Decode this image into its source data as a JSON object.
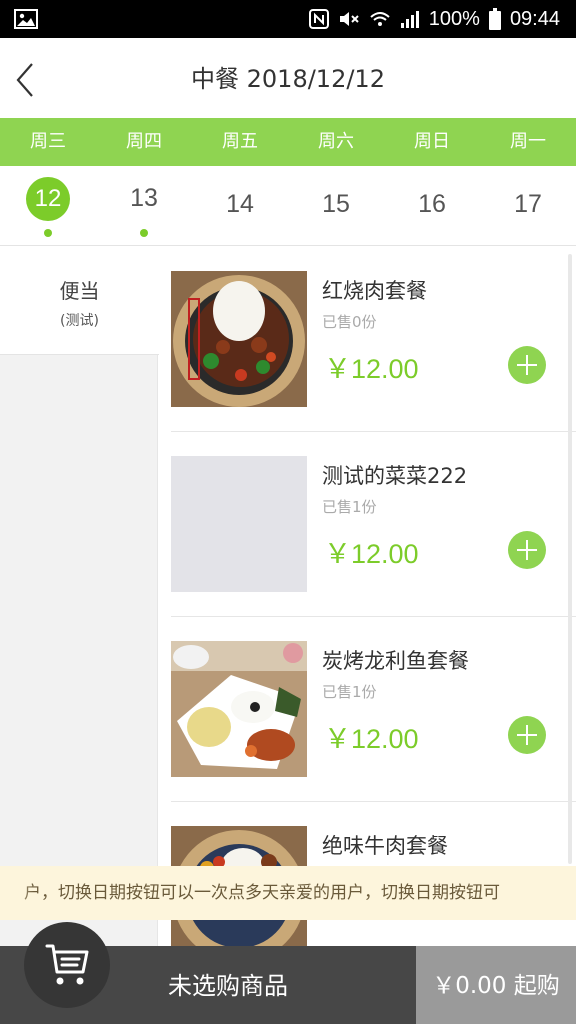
{
  "status_bar": {
    "battery": "100%",
    "time": "09:44"
  },
  "nav": {
    "title": "中餐 2018/12/12"
  },
  "weekdays": [
    "周三",
    "周四",
    "周五",
    "周六",
    "周日",
    "周一"
  ],
  "dates": [
    "12",
    "13",
    "14",
    "15",
    "16",
    "17"
  ],
  "selected_date": "12",
  "categories": [
    {
      "name": "便当",
      "sub": "(测试)"
    }
  ],
  "dishes": [
    {
      "name": "红烧肉套餐",
      "sold": "已售0份",
      "price": "￥12.00"
    },
    {
      "name": "测试的菜菜222",
      "sold": "已售1份",
      "price": "￥12.00"
    },
    {
      "name": "炭烤龙利鱼套餐",
      "sold": "已售1份",
      "price": "￥12.00"
    },
    {
      "name": "绝味牛肉套餐"
    }
  ],
  "notice": "户，切换日期按钮可以一次点多天亲爱的用户，切换日期按钮可",
  "cart": {
    "status": "未选购商品",
    "checkout": "￥0.00 起购"
  },
  "colors": {
    "accent_green": "#8fd451",
    "price_green": "#7ccc2a",
    "bottom_bar": "#474747"
  },
  "icons": [
    "image-icon",
    "nfc-icon",
    "mute-icon",
    "wifi-icon",
    "signal-icon",
    "battery-icon",
    "back-arrow-icon",
    "cart-icon",
    "plus-icon"
  ]
}
